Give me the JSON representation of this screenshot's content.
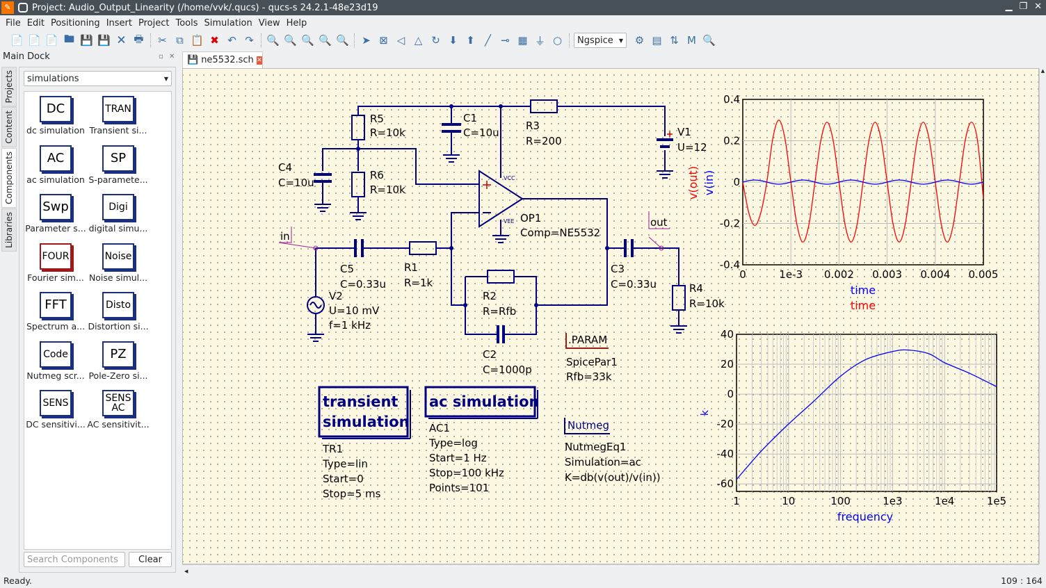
{
  "window": {
    "title": "Project: Audio_Output_Linearity (/home/vvk/.qucs) - qucs-s 24.2.1-48e23d19",
    "app_logo": "Qucs"
  },
  "menu": [
    "File",
    "Edit",
    "Positioning",
    "Insert",
    "Project",
    "Tools",
    "Simulation",
    "View",
    "Help"
  ],
  "toolbar": {
    "groups": [
      [
        {
          "icon": "new-document-icon",
          "glyph": "📄"
        },
        {
          "icon": "new-text-icon",
          "glyph": "📄"
        },
        {
          "icon": "new-symbol-icon",
          "glyph": "📄"
        },
        {
          "icon": "open-icon",
          "glyph": "🖿"
        },
        {
          "icon": "save-icon",
          "glyph": "💾"
        },
        {
          "icon": "save-all-icon",
          "glyph": "💾"
        },
        {
          "icon": "close-document-icon",
          "glyph": "🗙"
        },
        {
          "icon": "print-icon",
          "glyph": "🖶"
        }
      ],
      [
        {
          "icon": "cut-icon",
          "glyph": "✂"
        },
        {
          "icon": "copy-icon",
          "glyph": "⧉"
        },
        {
          "icon": "paste-icon",
          "glyph": "📋"
        },
        {
          "icon": "delete-icon",
          "glyph": "✖"
        },
        {
          "icon": "undo-icon",
          "glyph": "↶"
        },
        {
          "icon": "redo-icon",
          "glyph": "↷"
        }
      ],
      [
        {
          "icon": "zoom-fit-icon",
          "glyph": "🔍"
        },
        {
          "icon": "zoom-selection-icon",
          "glyph": "🔍"
        },
        {
          "icon": "zoom-1-1-icon",
          "glyph": "🔍"
        },
        {
          "icon": "zoom-in-icon",
          "glyph": "🔍"
        },
        {
          "icon": "zoom-out-icon",
          "glyph": "🔍"
        }
      ],
      [
        {
          "icon": "select-icon",
          "glyph": "➤"
        },
        {
          "icon": "edit-activate-icon",
          "glyph": "⊠"
        },
        {
          "icon": "mirror-x-icon",
          "glyph": "◁"
        },
        {
          "icon": "mirror-y-icon",
          "glyph": "△"
        },
        {
          "icon": "rotate-icon",
          "glyph": "↻"
        },
        {
          "icon": "go-into-subcircuit-icon",
          "glyph": "⬇"
        },
        {
          "icon": "pop-out-icon",
          "glyph": "⬆"
        },
        {
          "icon": "wire-icon",
          "glyph": "╱"
        },
        {
          "icon": "wire-label-icon",
          "glyph": "⊸"
        },
        {
          "icon": "equation-icon",
          "glyph": "▦"
        },
        {
          "icon": "ground-icon",
          "glyph": "⏚"
        },
        {
          "icon": "port-icon",
          "glyph": "○"
        }
      ]
    ],
    "simulator": "Ngspice",
    "after": [
      {
        "icon": "simulate-icon",
        "glyph": "⚙"
      },
      {
        "icon": "display-dpl-icon",
        "glyph": "▤"
      },
      {
        "icon": "set-marker-icon",
        "glyph": "⇅"
      },
      {
        "icon": "tune-icon",
        "glyph": "M"
      },
      {
        "icon": "optimize-icon",
        "glyph": "🔍"
      }
    ]
  },
  "dock": {
    "title": "Main Dock",
    "side_tabs": [
      "Projects",
      "Content",
      "Components",
      "Libraries"
    ],
    "selected_tab": "Components",
    "category": "simulations",
    "components": [
      {
        "icon": "DC",
        "label": "dc simulation"
      },
      {
        "icon": "TRAN",
        "label": "Transient si..."
      },
      {
        "icon": "AC",
        "label": "ac simulation"
      },
      {
        "icon": "SP",
        "label": "S-paramete..."
      },
      {
        "icon": "Swp",
        "label": "Parameter s..."
      },
      {
        "icon": "Digi",
        "label": "digital simu..."
      },
      {
        "icon": "FOUR",
        "label": "Fourier sim..."
      },
      {
        "icon": "Noise",
        "label": "Noise simul..."
      },
      {
        "icon": "FFT",
        "label": "Spectrum a..."
      },
      {
        "icon": "Disto",
        "label": "Distortion si..."
      },
      {
        "icon": "Code",
        "label": "Nutmeg scr..."
      },
      {
        "icon": "PZ",
        "label": "Pole-Zero si..."
      },
      {
        "icon": "SENS",
        "label": "DC sensitivi..."
      },
      {
        "icon": "SENS AC",
        "label": "AC sensitivit..."
      }
    ],
    "search_placeholder": "Search Components",
    "clear_label": "Clear"
  },
  "editor": {
    "tab": "ne5532.sch"
  },
  "schematic": {
    "R5": [
      "R5",
      "R=10k"
    ],
    "R6": [
      "R6",
      "R=10k"
    ],
    "C1": [
      "C1",
      "C=10u"
    ],
    "R3": [
      "R3",
      "R=200"
    ],
    "V1": [
      "V1",
      "U=12"
    ],
    "C4": [
      "C4",
      "C=10u"
    ],
    "OP1": [
      "OP1",
      "Comp=NE5532"
    ],
    "vcc": "VCC",
    "vee": "VEE",
    "C5": [
      "C5",
      "C=0.33u"
    ],
    "R1": [
      "R1",
      "R=1k"
    ],
    "V2": [
      "V2",
      "U=10 mV",
      "f=1 kHz"
    ],
    "R2": [
      "R2",
      "R=Rfb"
    ],
    "C2": [
      "C2",
      "C=1000p"
    ],
    "C3": [
      "C3",
      "C=0.33u"
    ],
    "R4": [
      "R4",
      "R=10k"
    ],
    "in_label": "in",
    "out_label": "out",
    "param": {
      "tag": ".PARAM",
      "name": "SpicePar1",
      "value": "Rfb=33k"
    },
    "nutmeg": {
      "tag": "Nutmeg",
      "lines": [
        "NutmegEq1",
        "Simulation=ac",
        "K=db(v(out)/v(in))"
      ]
    },
    "tran": {
      "title1": "transient",
      "title2": "simulation",
      "lines": [
        "TR1",
        "Type=lin",
        "Start=0",
        "Stop=5 ms"
      ]
    },
    "ac": {
      "title": "ac simulation",
      "lines": [
        "AC1",
        "Type=log",
        "Start=1 Hz",
        "Stop=100 kHz",
        "Points=101"
      ]
    }
  },
  "chart_data": [
    {
      "type": "line",
      "xlim": [
        0,
        0.005
      ],
      "ylim": [
        -0.4,
        0.4
      ],
      "grid": true,
      "xticks": [
        "0",
        "1e-3",
        "0.002",
        "0.003",
        "0.004",
        "0.005"
      ],
      "yticks": [
        "0.4",
        "0.2",
        "0",
        "-0.2",
        "-0.4"
      ],
      "xlabels": [
        {
          "text": "time",
          "color": "#0000ff"
        },
        {
          "text": "time",
          "color": "#ff0000"
        }
      ],
      "ylabels": [
        {
          "text": "v(out)",
          "color": "#ff0000"
        },
        {
          "text": "v(in)",
          "color": "#0000ff"
        }
      ],
      "x_step": 0.000125,
      "series": [
        {
          "name": "v(out)",
          "color": "#ff0000",
          "values": [
            0,
            -0.148,
            -0.21,
            -0.148,
            0,
            0.212,
            0.3,
            0.212,
            0,
            -0.205,
            -0.29,
            -0.205,
            0,
            0.205,
            0.29,
            0.205,
            0,
            -0.205,
            -0.29,
            -0.205,
            0,
            0.205,
            0.29,
            0.205,
            0,
            -0.205,
            -0.29,
            -0.205,
            0,
            0.205,
            0.29,
            0.205,
            0,
            -0.205,
            -0.29,
            -0.205,
            0,
            0.205,
            0.29,
            0.205,
            -0.08
          ]
        },
        {
          "name": "v(in)",
          "color": "#0000ff",
          "values": [
            0,
            0.007,
            0.01,
            0.007,
            0,
            -0.007,
            -0.01,
            -0.007,
            0,
            0.007,
            0.01,
            0.007,
            0,
            -0.007,
            -0.01,
            -0.007,
            0,
            0.007,
            0.01,
            0.007,
            0,
            -0.007,
            -0.01,
            -0.007,
            0,
            0.007,
            0.01,
            0.007,
            0,
            -0.007,
            -0.01,
            -0.007,
            0,
            0.007,
            0.01,
            0.007,
            0,
            -0.007,
            -0.01,
            -0.007,
            0
          ]
        }
      ]
    },
    {
      "type": "line",
      "xscale": "log",
      "xlim": [
        1,
        100000
      ],
      "ylim": [
        -65,
        40
      ],
      "grid": true,
      "xticks": [
        "1",
        "10",
        "100",
        "1e3",
        "1e4",
        "1e5"
      ],
      "yticks": [
        "40",
        "20",
        "0",
        "-20",
        "-40",
        "-60"
      ],
      "xlabel": "frequency",
      "ylabel": "k",
      "series": [
        {
          "name": "k",
          "color": "#0000ff",
          "x": [
            1,
            3,
            10,
            30,
            100,
            300,
            1000,
            2000,
            5000,
            10000,
            30000,
            100000
          ],
          "values": [
            -57,
            -38,
            -20,
            -5,
            12,
            23,
            28.5,
            29.5,
            27,
            21,
            14,
            5
          ]
        }
      ]
    }
  ],
  "status": {
    "text": "Ready.",
    "position": "109 : 164"
  }
}
